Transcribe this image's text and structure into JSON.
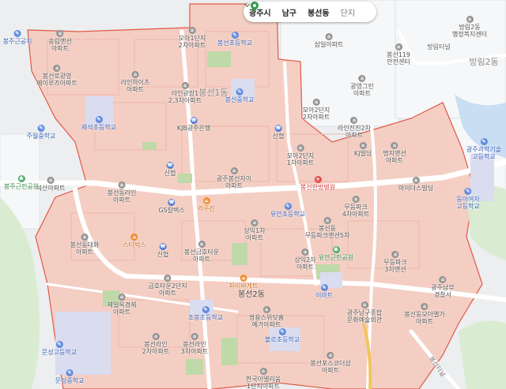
{
  "breadcrumb": {
    "city": "광주시",
    "district": "남구",
    "dong": "봉선동",
    "level": "단지"
  },
  "colors": {
    "highlight_fill": "#f6c8bb",
    "highlight_border": "#e0584a",
    "poi_pin": "#888888",
    "school": "#5b88e0",
    "bank": "#3f6fd6",
    "food": "#f08a2c",
    "hospital": "#e04848",
    "park": "#44a860",
    "location_pin": "#2e9a4a"
  },
  "areas": {
    "bongseon1": "봉선1동",
    "bongseon2": "봉선2동",
    "bangrim2": "방림2동",
    "bangrim_tunnel": "방림터널"
  },
  "pois": [
    {
      "id": "apt-songrim",
      "text": [
        "송림맨션",
        "아파트"
      ],
      "icon": "apt"
    },
    {
      "id": "apt-bongseon-gyeongyeong",
      "text": [
        "봉선로광영",
        "메이루즈아파트"
      ],
      "icon": "apt"
    },
    {
      "id": "apt-moa1",
      "text": [
        "모아1단지",
        "2차아파트"
      ],
      "icon": "apt"
    },
    {
      "id": "school-bongseon-elem-top",
      "text": [
        "봉선초등학교"
      ],
      "icon": "school"
    },
    {
      "id": "apt-samil",
      "text": [
        "삼일아파트"
      ],
      "icon": "apt"
    },
    {
      "id": "bongseon-bangrim-welfare",
      "text": [
        "방림2동",
        "행정복지센터"
      ],
      "icon": "apt"
    },
    {
      "id": "fire-station",
      "text": [
        "봉선119",
        "안전센터"
      ],
      "icon": "apt"
    },
    {
      "id": "apt-lineheights",
      "text": [
        "라인하이츠",
        "아파트"
      ],
      "icon": "apt"
    },
    {
      "id": "apt-lineggwangjang",
      "text": [
        "라인광장1",
        "2,3차아파트"
      ],
      "icon": "apt"
    },
    {
      "id": "school-bongseon-middle",
      "text": [
        "봉선중학교"
      ],
      "icon": "school"
    },
    {
      "id": "apt-gwangyeong-green",
      "text": [
        "광영그린",
        "아파트"
      ],
      "icon": "apt"
    },
    {
      "id": "apt-moa2",
      "text": [
        "모아2단지",
        "2차아파트"
      ],
      "icon": "apt"
    },
    {
      "id": "apt-linejingjin",
      "text": [
        "라인진진2차",
        "아파트"
      ],
      "icon": "apt"
    },
    {
      "id": "school-jeseok-elem",
      "text": [
        "제석초등학교"
      ],
      "icon": "school"
    },
    {
      "id": "school-juwol-middle",
      "text": [
        "주월중학교"
      ],
      "icon": "school"
    },
    {
      "id": "bank-kjb",
      "text": [
        "KJB광주은행"
      ],
      "icon": "bank"
    },
    {
      "id": "bank-shinhyup-1",
      "text": [
        "신협"
      ],
      "icon": "bank"
    },
    {
      "id": "apt-moa2-1",
      "text": [
        "모아2단지",
        "1차아파트"
      ],
      "icon": "apt"
    },
    {
      "id": "bldg-kj",
      "text": [
        "KJ빌딩"
      ],
      "icon": "apt"
    },
    {
      "id": "apt-myeongji",
      "text": [
        "명지맨션",
        "아파트"
      ],
      "icon": "apt"
    },
    {
      "id": "school-science-tech",
      "text": [
        "광주과학기술",
        "고등학교"
      ],
      "icon": "school"
    },
    {
      "id": "park-bongju",
      "text": [
        "봉주근린공원"
      ],
      "icon": "park"
    },
    {
      "id": "apt-deoksan",
      "text": [
        "덕산아파트"
      ],
      "icon": "apt"
    },
    {
      "id": "apt-bongseon-line",
      "text": [
        "봉선동라인",
        "아파트"
      ],
      "icon": "apt"
    },
    {
      "id": "bank-shinhyup-2",
      "text": [
        "신협"
      ],
      "icon": "bank"
    },
    {
      "id": "apt-gwangju-bongseon-xi",
      "text": [
        "광주봉선자이",
        "아파트"
      ],
      "icon": "apt"
    },
    {
      "id": "hospital-bongseon-hanbang",
      "text": [
        "봉선한방병원"
      ],
      "icon": "hospital"
    },
    {
      "id": "bldg-mighty",
      "text": [
        "마이더스빌딩"
      ],
      "icon": "apt"
    },
    {
      "id": "school-dongajeon",
      "text": [
        "동아여자",
        "고등학교"
      ],
      "icon": "school"
    },
    {
      "id": "gs-the-fresh",
      "text": [
        "GS칼텍스"
      ],
      "icon": "bank"
    },
    {
      "id": "food-lajuzin",
      "text": [
        "라주진"
      ],
      "icon": "food"
    },
    {
      "id": "school-yuan-elem",
      "text": [
        "유안초등학교"
      ],
      "icon": "school"
    },
    {
      "id": "apt-mudeung-park4",
      "text": [
        "무등파크",
        "4차아파트"
      ],
      "icon": "apt"
    },
    {
      "id": "apt-mudeung-park-xi",
      "text": [
        "봉선동",
        "무등파크맨션5차"
      ],
      "icon": "apt"
    },
    {
      "id": "apt-sangik1",
      "text": [
        "상익1차",
        "아파트"
      ],
      "icon": "apt"
    },
    {
      "id": "apt-bongseon-daewha",
      "text": [
        "봉선동대화",
        "아파트"
      ],
      "icon": "apt"
    },
    {
      "id": "food-starbucks",
      "text": [
        "스타벅스"
      ],
      "icon": "food"
    },
    {
      "id": "bank-shinhyup-3",
      "text": [
        "신협"
      ],
      "icon": "bank"
    },
    {
      "id": "apt-bongseon-geumho",
      "text": [
        "봉선금호타운",
        "아파트"
      ],
      "icon": "apt"
    },
    {
      "id": "apt-sangik2",
      "text": [
        "상익2차",
        "아파트"
      ],
      "icon": "apt"
    },
    {
      "id": "park-yuan",
      "text": [
        "유안근린공원"
      ],
      "icon": "park"
    },
    {
      "id": "apt-mudeung-park3",
      "text": [
        "무등파크",
        "3차맨션"
      ],
      "icon": "apt"
    },
    {
      "id": "apt-geumho-town2",
      "text": [
        "금호타운2단지",
        "아파트"
      ],
      "icon": "apt"
    },
    {
      "id": "food-paris",
      "text": [
        "파리바게트"
      ],
      "icon": "food"
    },
    {
      "id": "apt-jeil-ok",
      "text": [
        "제일옥경제",
        "아파트"
      ],
      "icon": "apt"
    },
    {
      "id": "apt-ssangyong",
      "text": [
        "쌍용스위닷홈",
        "예가아파트"
      ],
      "icon": "apt"
    },
    {
      "id": "emart",
      "text": [
        "이마트"
      ],
      "icon": "school"
    },
    {
      "id": "bldg-gwangju-namgu",
      "text": [
        "광주남구종합",
        "문화예술회관"
      ],
      "icon": "apt"
    },
    {
      "id": "apt-bongseon-moa",
      "text": [
        "봉선동모아엘가",
        "아파트"
      ],
      "icon": "apt"
    },
    {
      "id": "school-gwangju-namgu-police",
      "text": [
        "광주남부",
        "경찰서"
      ],
      "icon": "apt"
    },
    {
      "id": "school-joyang-elem",
      "text": [
        "조봉초등학교"
      ],
      "icon": "school"
    },
    {
      "id": "school-bulro-elem",
      "text": [
        "불로초등학교"
      ],
      "icon": "school"
    },
    {
      "id": "apt-bongseon-line2",
      "text": [
        "봉선라인",
        "2차아파트"
      ],
      "icon": "apt"
    },
    {
      "id": "apt-bongseon-line3",
      "text": [
        "봉선라인",
        "3차아파트"
      ],
      "icon": "apt"
    },
    {
      "id": "school-munseong-high",
      "text": [
        "문성고등학교"
      ],
      "icon": "school"
    },
    {
      "id": "school-munseong-middle",
      "text": [
        "문성중학교"
      ],
      "icon": "school"
    },
    {
      "id": "apt-bongseon-posco",
      "text": [
        "봉선포스코더샵",
        "아파트"
      ],
      "icon": "apt"
    },
    {
      "id": "apt-hanguk-arumdaum",
      "text": [
        "한국아델리움",
        "1단지아파트"
      ],
      "icon": "apt"
    },
    {
      "id": "road-bongseon",
      "text": [
        "봉선터널"
      ],
      "icon": "none"
    },
    {
      "id": "park-top-left",
      "text": [
        "봉주근공지"
      ],
      "icon": "school"
    }
  ]
}
